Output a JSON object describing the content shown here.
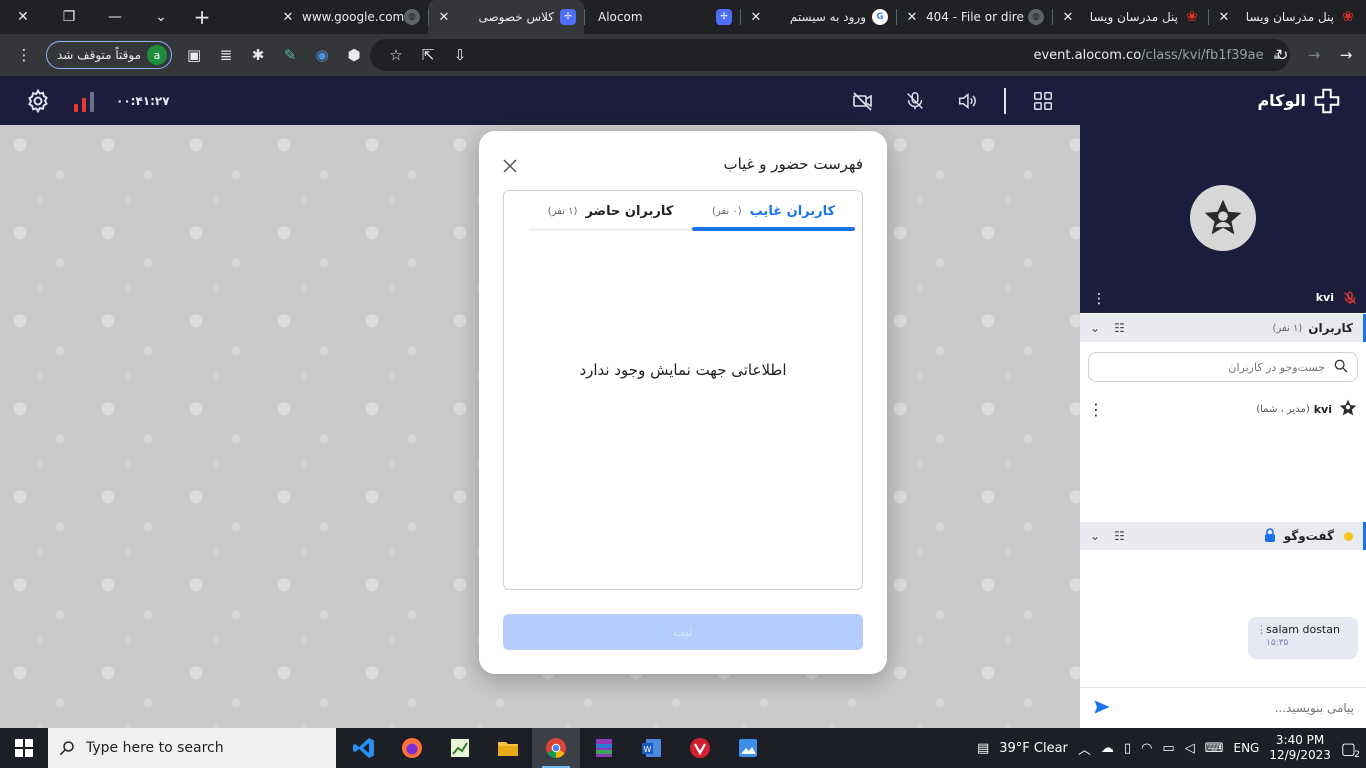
{
  "browser": {
    "tabs": [
      {
        "title": "پنل مدرسان ویسا",
        "icon": "red-flower-icon",
        "active": false
      },
      {
        "title": "پنل مدرسان ویسا",
        "icon": "red-flower-icon",
        "active": false
      },
      {
        "title": "404 - File or dire",
        "icon": "globe-icon",
        "active": false
      },
      {
        "title": "ورود به سیستم",
        "icon": "google-icon",
        "active": false
      },
      {
        "title": "Alocom",
        "icon": "alocom-icon",
        "active": false
      },
      {
        "title": "کلاس خصوصی",
        "icon": "alocom-icon",
        "active": true
      },
      {
        "title": "www.google.com",
        "icon": "globe-icon",
        "active": false
      }
    ],
    "profile_label": "موقتاً متوقف شد",
    "profile_initial": "a",
    "url_host": "event.alocom.co",
    "url_path": "/class/kvi/fb1f39ae"
  },
  "header": {
    "timer": "۰۰:۴۱:۲۷",
    "brand": "الوکام"
  },
  "modal": {
    "title": "فهرست حضور و غیاب",
    "tab_absent_label": "کاربران غایب",
    "tab_absent_count": "(۰ نفر)",
    "tab_present_label": "کاربران حاضر",
    "tab_present_count": "(۱ نفر)",
    "empty_message": "اطلاعاتی جهت نمایش وجود ندارد",
    "submit_label": "ثبت"
  },
  "panel": {
    "tile_name": "kvi",
    "users_title": "کاربران",
    "users_count": "(۱ نفر)",
    "search_placeholder": "جست‌وجو در کاربران",
    "user_name": "kvi",
    "user_role": "(مدیر ، شما)",
    "chat_title": "گفت‌وگو",
    "message_text": "salam dostan",
    "message_time": "۱۵:۳۵",
    "composer_placeholder": "پیامی بنویسید..."
  },
  "taskbar": {
    "search_placeholder": "Type here to search",
    "weather": "39°F  Clear",
    "lang": "ENG",
    "time": "3:40 PM",
    "date": "12/9/2023",
    "notifications": "2"
  },
  "colors": {
    "accent": "#1a73e8",
    "header_bg": "#1c1d3c",
    "mic_off": "#e53935"
  }
}
